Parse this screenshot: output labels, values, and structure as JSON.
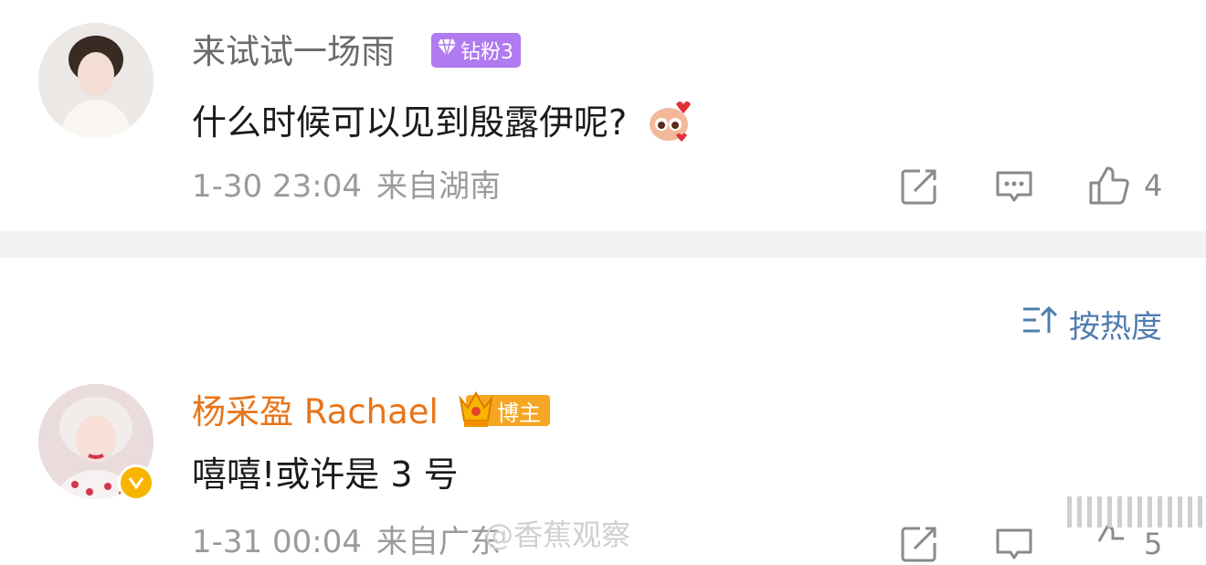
{
  "comments": [
    {
      "username": "来试试一场雨",
      "badge": {
        "label": "钻粉3",
        "icon": "diamond-icon"
      },
      "text": "什么时候可以见到殷露伊呢?",
      "emoji": "cute-emoji-sticker",
      "timestamp": "1-30 23:04",
      "location": "来自湖南",
      "likes": "4"
    },
    {
      "username": "杨采盈 Rachael",
      "badge": {
        "label": "博主",
        "icon": "crown-icon"
      },
      "text": "嘻嘻!或许是 3 号",
      "verified": true,
      "timestamp": "1-31 00:04",
      "location": "来自广东",
      "likes": "5"
    }
  ],
  "sort": {
    "label": "按热度",
    "icon": "sort-icon"
  },
  "watermark": {
    "text": "@香蕉观察"
  },
  "colors": {
    "username_gray": "#6b6b6b",
    "username_orange": "#e8751a",
    "link_blue": "#507daf",
    "divider": "#f2f2f2",
    "fan_badge": "#b07af0",
    "blogger_badge": "#f5a623"
  }
}
